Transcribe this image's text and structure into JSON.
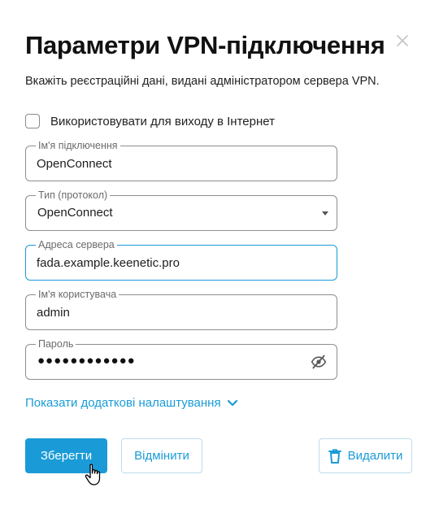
{
  "dialog": {
    "title": "Параметри VPN-підключення",
    "subtitle": "Вкажіть реєстраційні дані, видані адміністратором сервера VPN.",
    "close_icon": "close-icon"
  },
  "internet_checkbox": {
    "label": "Використовувати для виходу в Інтернет",
    "checked": false
  },
  "fields": {
    "connection_name": {
      "label": "Ім'я підключення",
      "value": "OpenConnect"
    },
    "protocol": {
      "label": "Тип (протокол)",
      "value": "OpenConnect"
    },
    "server_address": {
      "label": "Адреса сервера",
      "value": "fada.example.keenetic.pro"
    },
    "username": {
      "label": "Ім'я користувача",
      "value": "admin"
    },
    "password": {
      "label": "Пароль",
      "masked_value": "●●●●●●●●●●●●"
    }
  },
  "advanced_link": {
    "label": "Показати додаткові налаштування"
  },
  "buttons": {
    "save": "Зберегти",
    "cancel": "Відмінити",
    "delete": "Видалити"
  },
  "colors": {
    "accent": "#1a9bd7",
    "border": "#8e8e8e",
    "text": "#1d1d1f"
  },
  "icons": [
    "close-icon",
    "chevron-down-icon",
    "eye-slash-icon",
    "trash-icon",
    "hand-cursor-icon"
  ]
}
